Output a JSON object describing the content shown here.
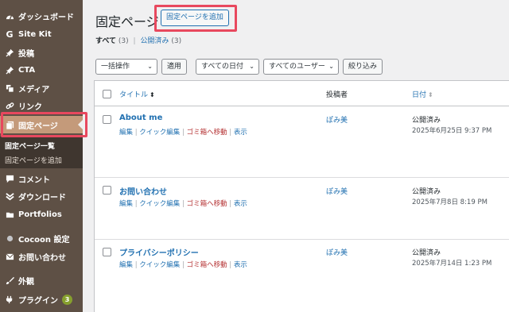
{
  "sidebar": {
    "items": [
      {
        "label": "ダッシュボード",
        "icon": "dashboard-icon"
      },
      {
        "label": "Site Kit",
        "icon": "sitekit-icon"
      },
      {
        "label": "投稿",
        "icon": "pin-icon"
      },
      {
        "label": "CTA",
        "icon": "pin-icon"
      },
      {
        "label": "メディア",
        "icon": "media-icon"
      },
      {
        "label": "リンク",
        "icon": "link-icon"
      },
      {
        "label": "固定ページ",
        "icon": "page-icon"
      },
      {
        "label": "コメント",
        "icon": "comment-icon"
      },
      {
        "label": "ダウンロード",
        "icon": "download-icon"
      },
      {
        "label": "Portfolios",
        "icon": "folder-icon"
      },
      {
        "label": "Cocoon 設定",
        "icon": "circle-icon"
      },
      {
        "label": "お問い合わせ",
        "icon": "mail-icon"
      },
      {
        "label": "外観",
        "icon": "brush-icon"
      },
      {
        "label": "プラグイン",
        "icon": "plugin-icon",
        "badge": "3"
      }
    ],
    "submenu": [
      {
        "label": "固定ページ一覧"
      },
      {
        "label": "固定ページを追加"
      }
    ]
  },
  "header": {
    "title": "固定ページ",
    "add_button": "固定ページを追加"
  },
  "filters": {
    "all_label": "すべて",
    "all_count": "(3)",
    "published_label": "公開済み",
    "published_count": "(3)"
  },
  "toolbar": {
    "bulk_action": "一括操作",
    "apply": "適用",
    "all_dates": "すべての日付",
    "all_users": "すべてのユーザー",
    "filter": "絞り込み"
  },
  "table": {
    "headers": {
      "title": "タイトル",
      "author": "投稿者",
      "date": "日付"
    },
    "actions": {
      "edit": "編集",
      "quick_edit": "クイック編集",
      "trash": "ゴミ箱へ移動",
      "view": "表示"
    },
    "rows": [
      {
        "title": "About me",
        "author": "ぽみ美",
        "status": "公開済み",
        "date": "2025年6月25日 9:37 PM"
      },
      {
        "title": "お問い合わせ",
        "author": "ぽみ美",
        "status": "公開済み",
        "date": "2025年7月8日 8:19 PM"
      },
      {
        "title": "プライバシーポリシー",
        "author": "ぽみ美",
        "status": "公開済み",
        "date": "2025年7月14日 1:23 PM"
      }
    ]
  },
  "colors": {
    "sidebar_bg": "#5e5045",
    "sidebar_current": "#c49a7a",
    "link": "#2271b1",
    "trash": "#b32d2e",
    "highlight": "#e8485e"
  }
}
